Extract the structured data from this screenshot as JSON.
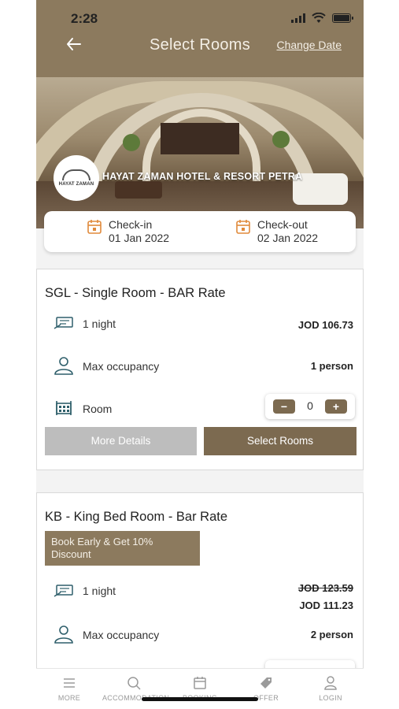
{
  "status_bar": {
    "time": "2:28"
  },
  "header": {
    "title": "Select Rooms",
    "change_date": "Change Date"
  },
  "hotel": {
    "name": "HAYAT ZAMAN HOTEL & RESORT PETRA",
    "logo_text": "HAYAT ZAMAN"
  },
  "dates": {
    "checkin_label": "Check-in",
    "checkin_value": "01 Jan 2022",
    "checkout_label": "Check-out",
    "checkout_value": "02 Jan 2022"
  },
  "rooms": [
    {
      "title": "SGL - Single Room - BAR Rate",
      "nights": "1 night",
      "price": "JOD 106.73",
      "occupancy_label": "Max occupancy",
      "occupancy_value": "1 person",
      "room_label": "Room",
      "quantity": "0",
      "minus": "−",
      "plus": "+",
      "more_details": "More Details",
      "select_rooms": "Select Rooms"
    },
    {
      "title": "KB - King Bed Room  - Bar Rate",
      "promo": "Book Early & Get 10% Discount",
      "nights": "1 night",
      "old_price": "JOD 123.59",
      "price": "JOD 111.23",
      "occupancy_label": "Max occupancy",
      "occupancy_value": "2 person"
    }
  ],
  "tabs": [
    {
      "label": "MORE",
      "icon": "menu-icon"
    },
    {
      "label": "ACCOMMODATION",
      "icon": "search-icon"
    },
    {
      "label": "BOOKING",
      "icon": "calendar-icon"
    },
    {
      "label": "OFFER",
      "icon": "tag-icon"
    },
    {
      "label": "LOGIN",
      "icon": "user-icon"
    }
  ],
  "colors": {
    "brand": "#8c7a5e",
    "accent_dark": "#7c6a50",
    "calendar_icon": "#e08a3c",
    "icon_teal": "#2f5f6b"
  }
}
